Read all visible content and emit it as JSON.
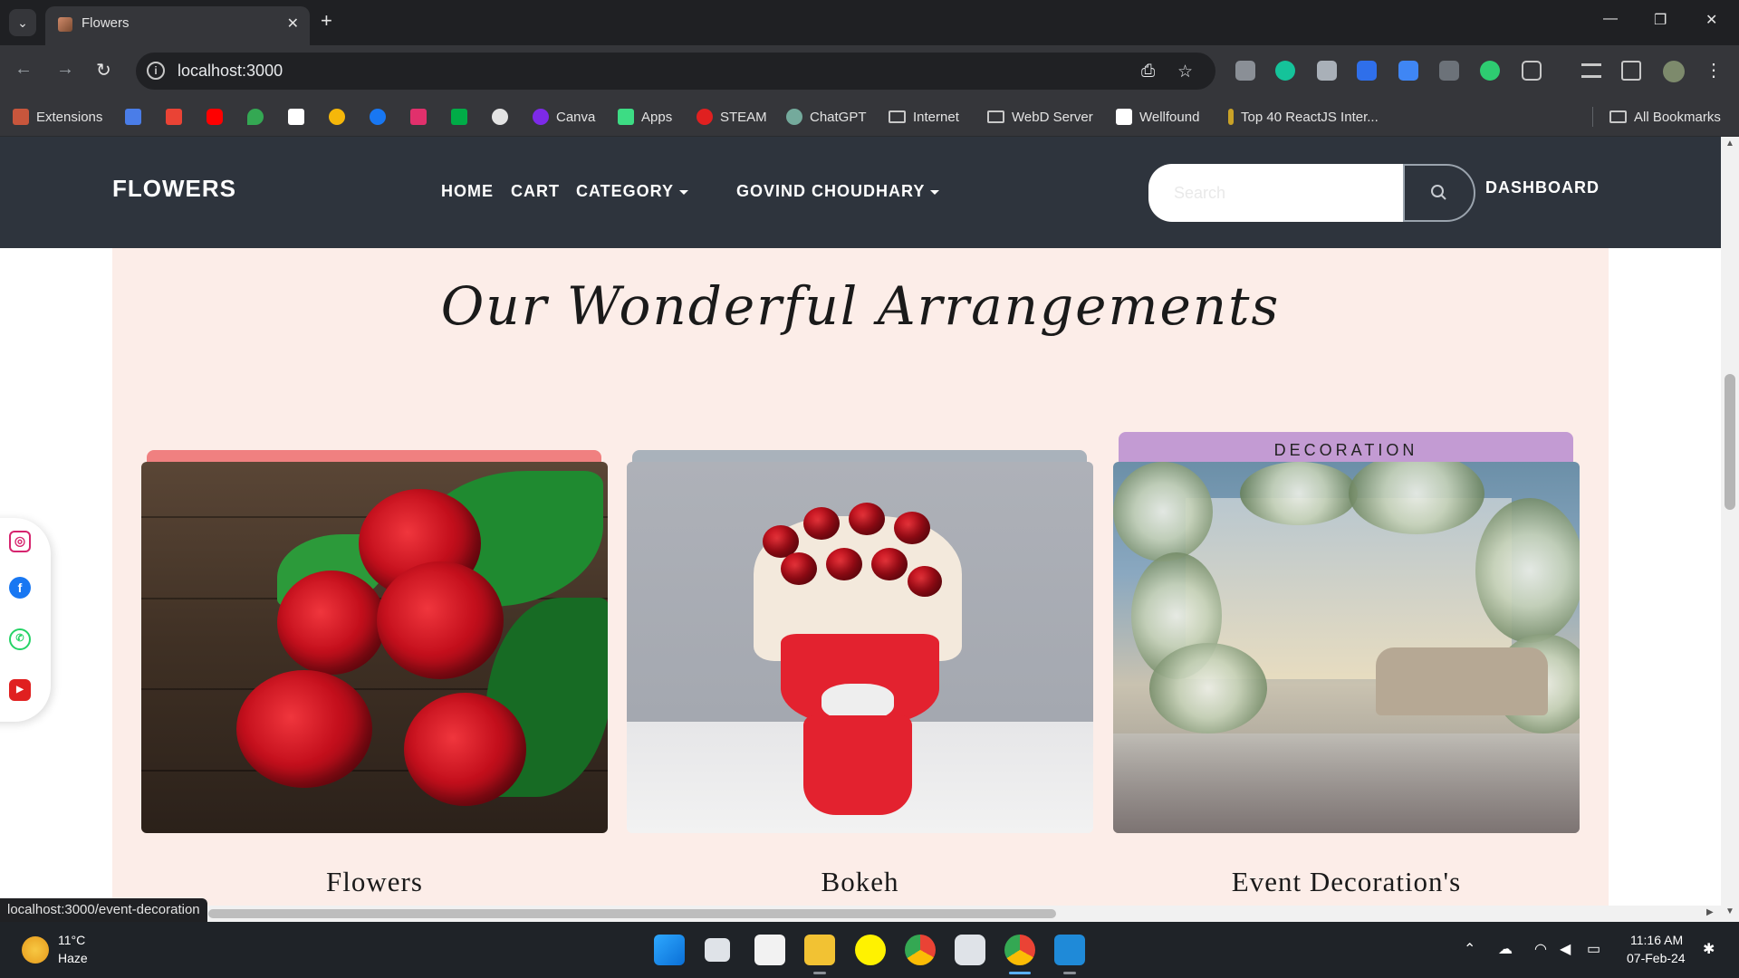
{
  "browser": {
    "tab_title": "Flowers",
    "url": "localhost:3000",
    "status_url": "localhost:3000/event-decoration",
    "bookmarks": [
      "Extensions",
      "Canva",
      "Apps",
      "STEAM",
      "ChatGPT",
      "Internet",
      "WebD Server",
      "Wellfound",
      "Top 40 ReactJS Inter...",
      "All Bookmarks"
    ]
  },
  "site": {
    "brand": "FLOWERS",
    "nav": {
      "home": "HOME",
      "cart": "CART",
      "category": "CATEGORY",
      "user": "GOVIND CHOUDHARY",
      "dashboard": "DASHBOARD"
    },
    "search": {
      "placeholder": "Search"
    },
    "section_title": "Our Wonderful Arrangements",
    "cards": [
      {
        "caption": "Flowers",
        "tab_color": "#f08080"
      },
      {
        "caption": "Bokeh",
        "tab_color": "#a9b2bb"
      },
      {
        "caption": "Event Decoration's",
        "tab_label": "DECORATION",
        "tab_color": "#c39bd3"
      }
    ],
    "social_icons": [
      "instagram-icon",
      "facebook-icon",
      "whatsapp-icon",
      "youtube-icon"
    ]
  },
  "taskbar": {
    "weather_temp": "11°C",
    "weather_desc": "Haze",
    "time": "11:16 AM",
    "date": "07-Feb-24"
  },
  "colors": {
    "navbar_bg": "#2e343d",
    "content_bg": "#fcede8",
    "chrome_bg": "#35363a"
  }
}
